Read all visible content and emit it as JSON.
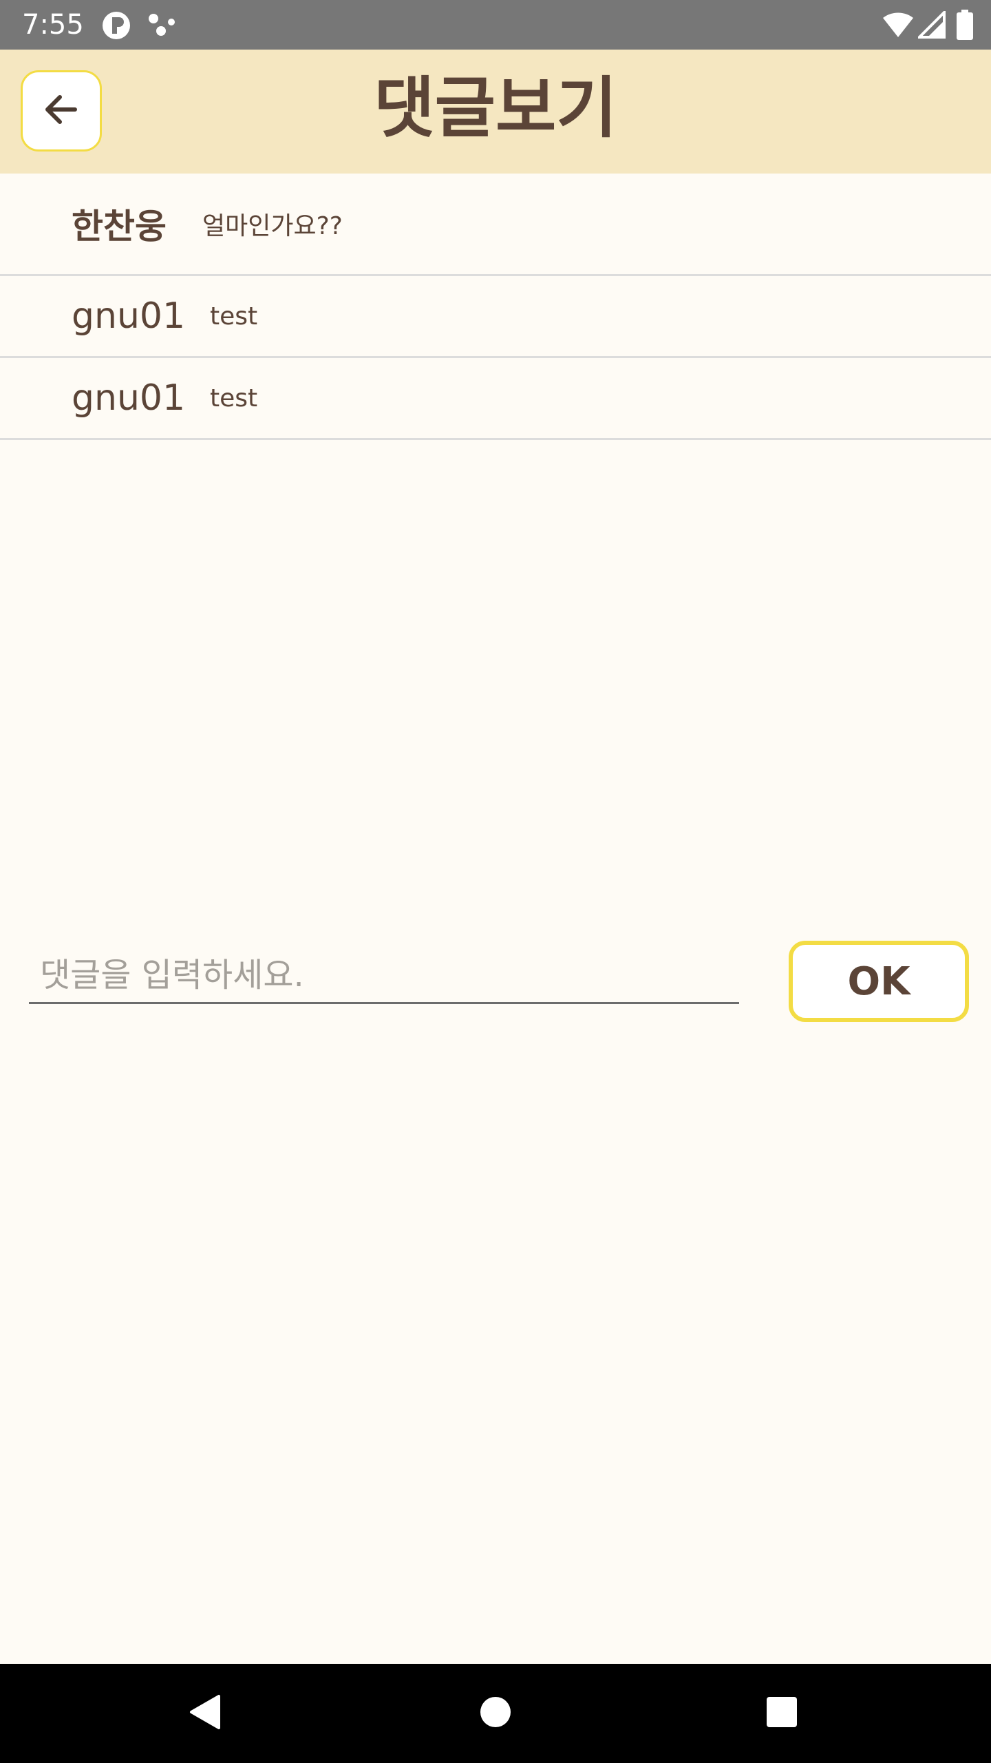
{
  "status_bar": {
    "time": "7:55",
    "icons": [
      "notification-p-icon",
      "dots-icon",
      "wifi-icon",
      "signal-icon",
      "battery-icon"
    ]
  },
  "header": {
    "title": "댓글보기",
    "back_icon": "arrow-left-icon"
  },
  "comments": [
    {
      "author": "한찬웅",
      "text": "얼마인가요??"
    },
    {
      "author": "gnu01",
      "text": "test"
    },
    {
      "author": "gnu01",
      "text": "test"
    }
  ],
  "input": {
    "placeholder": "댓글을 입력하세요.",
    "value": ""
  },
  "ok_button": {
    "label": "OK"
  },
  "nav_bar": {
    "icons": [
      "back-triangle-icon",
      "home-circle-icon",
      "recents-square-icon"
    ]
  },
  "colors": {
    "header_bg": "#f5e7c1",
    "accent_border": "#f3dc44",
    "text_brown": "#5b4437",
    "page_bg": "#fefbf5"
  }
}
